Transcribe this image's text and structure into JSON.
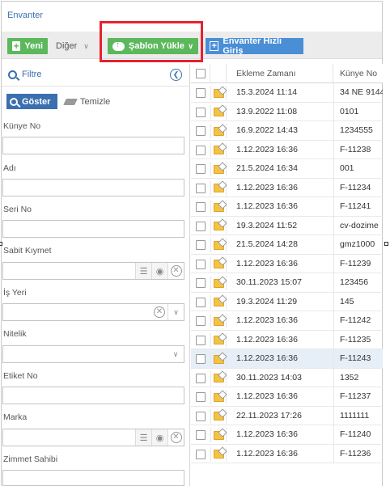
{
  "breadcrumb": "Envanter",
  "toolbar": {
    "new_label": "Yeni",
    "other_label": "Diğer",
    "template_label": "Şablon Yükle",
    "inventory_quick_label": "Envanter Hızlı Giriş"
  },
  "filter": {
    "title": "Filtre",
    "show_label": "Göster",
    "clear_label": "Temizle",
    "fields": [
      "Künye No",
      "Adı",
      "Seri No",
      "Sabit Kıymet",
      "İş Yeri",
      "Nitelik",
      "Etiket No",
      "Marka",
      "Zimmet Sahibi"
    ]
  },
  "grid": {
    "columns": [
      "Ekleme Zamanı",
      "Künye No"
    ],
    "rows": [
      {
        "time": "15.3.2024 11:14",
        "kunye": "34 NE 9144"
      },
      {
        "time": "13.9.2022 11:08",
        "kunye": "0101"
      },
      {
        "time": "16.9.2022 14:43",
        "kunye": "1234555"
      },
      {
        "time": "1.12.2023 16:36",
        "kunye": "F-11238"
      },
      {
        "time": "21.5.2024 16:34",
        "kunye": "001"
      },
      {
        "time": "1.12.2023 16:36",
        "kunye": "F-11234"
      },
      {
        "time": "1.12.2023 16:36",
        "kunye": "F-11241"
      },
      {
        "time": "19.3.2024 11:52",
        "kunye": "cv-dozime"
      },
      {
        "time": "21.5.2024 14:28",
        "kunye": "gmz1000"
      },
      {
        "time": "1.12.2023 16:36",
        "kunye": "F-11239"
      },
      {
        "time": "30.11.2023 15:07",
        "kunye": "123456"
      },
      {
        "time": "19.3.2024 11:29",
        "kunye": "145"
      },
      {
        "time": "1.12.2023 16:36",
        "kunye": "F-11242"
      },
      {
        "time": "1.12.2023 16:36",
        "kunye": "F-11235"
      },
      {
        "time": "1.12.2023 16:36",
        "kunye": "F-11243"
      },
      {
        "time": "30.11.2023 14:03",
        "kunye": "1352"
      },
      {
        "time": "1.12.2023 16:36",
        "kunye": "F-11237"
      },
      {
        "time": "22.11.2023 17:26",
        "kunye": "1111111"
      },
      {
        "time": "1.12.2023 16:36",
        "kunye": "F-11240"
      },
      {
        "time": "1.12.2023 16:36",
        "kunye": "F-11236"
      }
    ]
  }
}
